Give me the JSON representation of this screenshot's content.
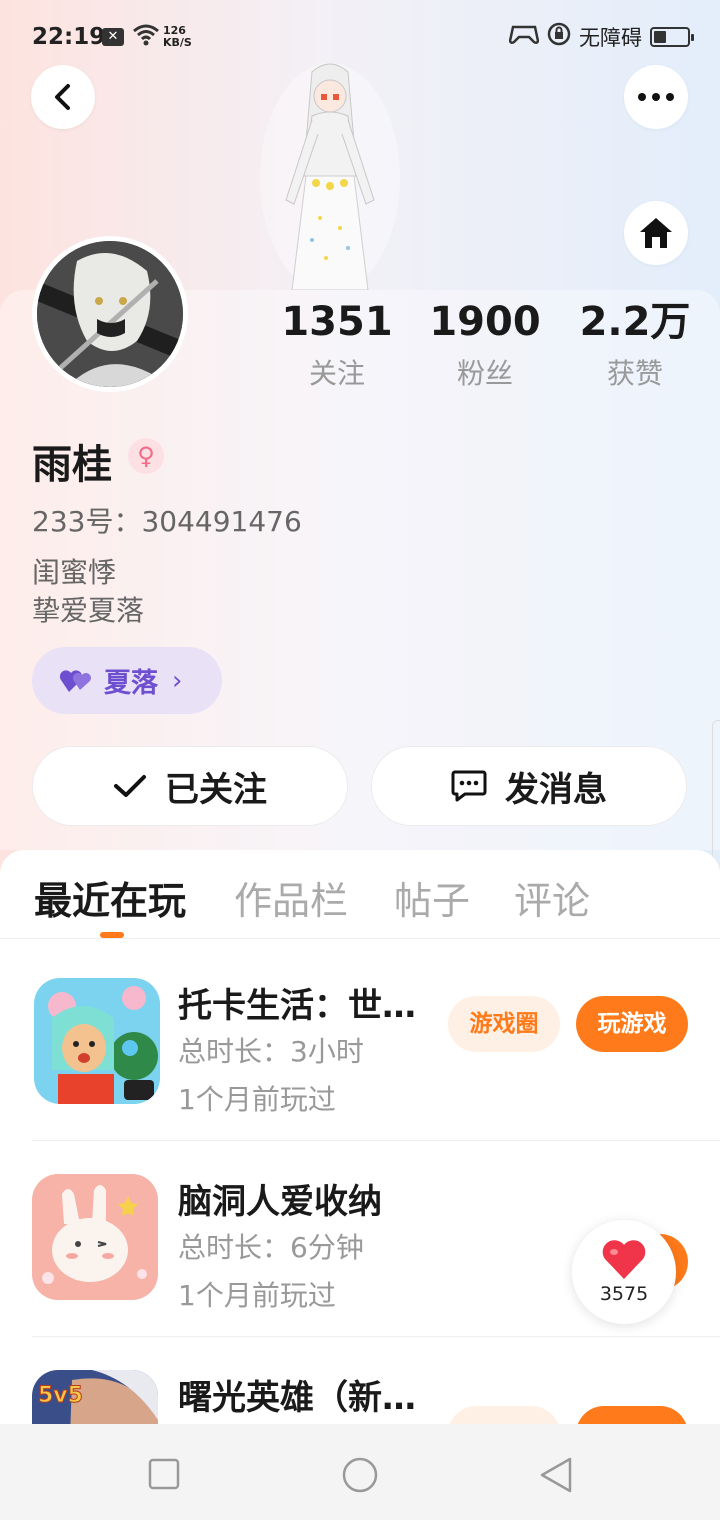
{
  "status_bar": {
    "time": "22:19",
    "speed_value": "126",
    "speed_unit": "KB/S",
    "accessibility_label": "无障碍"
  },
  "profile": {
    "name": "雨桂",
    "gender_symbol": "♀",
    "uid": "233号：304491476",
    "bio_lines": [
      "闺蜜悸",
      "挚爱夏落"
    ],
    "tag": {
      "label": "夏落",
      "chevron": "›"
    },
    "stats": [
      {
        "value": "1351",
        "label": "关注"
      },
      {
        "value": "1900",
        "label": "粉丝"
      },
      {
        "value": "2.2万",
        "label": "获赞"
      }
    ]
  },
  "actions": {
    "follow_label": "已关注",
    "message_label": "发消息"
  },
  "tabs": [
    {
      "label": "最近在玩",
      "active": true
    },
    {
      "label": "作品栏",
      "active": false
    },
    {
      "label": "帖子",
      "active": false
    },
    {
      "label": "评论",
      "active": false
    }
  ],
  "games": [
    {
      "title": "托卡生活：世…",
      "duration": "总时长：3小时",
      "last_played": "1个月前玩过",
      "circle_label": "游戏圈",
      "play_label": "玩游戏"
    },
    {
      "title": "脑洞人爱收纳",
      "duration": "总时长：6分钟",
      "last_played": "1个月前玩过",
      "circle_label": "",
      "play_label": ""
    },
    {
      "title": "曙光英雄（新…",
      "duration": "",
      "last_played": "",
      "circle_label": "",
      "play_label": "",
      "badge": "5v5"
    }
  ],
  "like_widget": {
    "count": "3575"
  },
  "colors": {
    "accent": "#ff7a1a",
    "tag_purple": "#6e4fd0",
    "gender_pink": "#f26a86"
  }
}
